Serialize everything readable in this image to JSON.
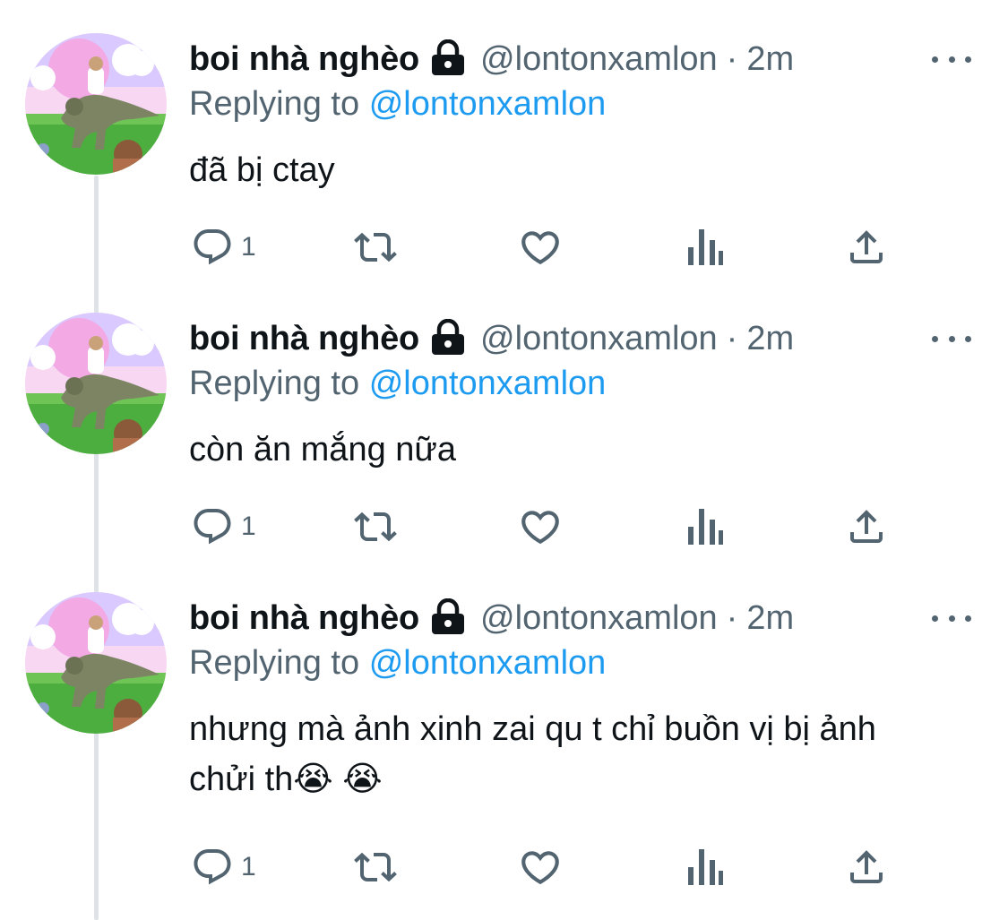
{
  "colors": {
    "accent": "#1d9bf0",
    "text": "#0f1419",
    "muted": "#536471",
    "thread": "#dfe3e7"
  },
  "tweets": [
    {
      "name": "boi nhà nghèo",
      "handle": "@lontonxamlon",
      "separator": "·",
      "time": "2m",
      "replying_prefix": "Replying to",
      "replying_to": "@lontonxamlon",
      "text": "đã bị ctay",
      "reply_count": "1"
    },
    {
      "name": "boi nhà nghèo",
      "handle": "@lontonxamlon",
      "separator": "·",
      "time": "2m",
      "replying_prefix": "Replying to",
      "replying_to": "@lontonxamlon",
      "text": "còn ăn mắng nữa",
      "reply_count": "1"
    },
    {
      "name": "boi nhà nghèo",
      "handle": "@lontonxamlon",
      "separator": "·",
      "time": "2m",
      "replying_prefix": "Replying to",
      "replying_to": "@lontonxamlon",
      "text": "nhưng mà ảnh xinh zai qu t chỉ buồn vị bị ảnh chửi th😭 😭",
      "reply_count": "1"
    }
  ],
  "icons": {
    "lock": "lock-icon",
    "more": "more-icon",
    "reply": "reply-icon",
    "retweet": "retweet-icon",
    "like": "heart-icon",
    "views": "views-icon",
    "share": "share-icon"
  }
}
